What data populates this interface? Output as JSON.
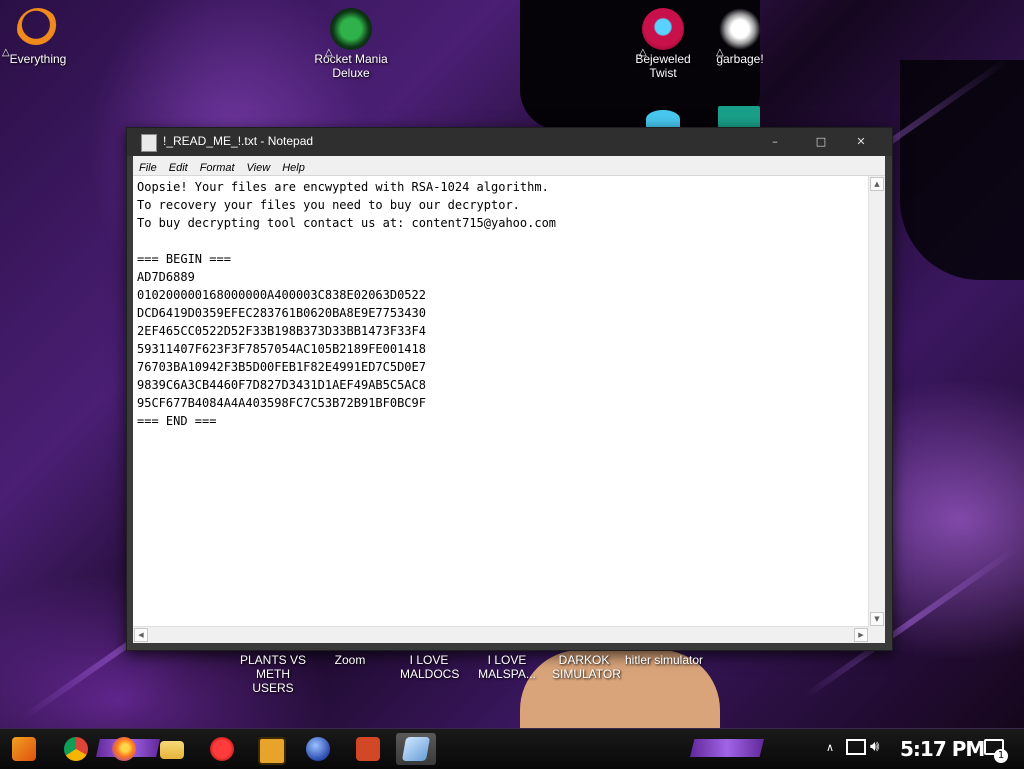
{
  "desktop": {
    "top_icons": [
      {
        "label": "Everything",
        "icon": "everything-search-icon",
        "color": "#f08a1c"
      },
      {
        "label": "Rocket Mania Deluxe",
        "icon": "rocket-mania-icon",
        "color": "#2fb24a"
      },
      {
        "label": "Bejeweled Twist",
        "icon": "bejeweled-gem-icon",
        "color": "#c8104a"
      },
      {
        "label": "garbage!",
        "icon": "garbage-dragon-icon",
        "color": "#ffffff"
      }
    ],
    "bottom_labels": [
      "PLANTS VS METH USERS",
      "Zoom",
      "I LOVE MALDOCS",
      "I LOVE MALSPA...",
      "DARKOK SIMULATOR",
      "hitler simulator"
    ]
  },
  "notepad": {
    "title": "!_READ_ME_!.txt - Notepad",
    "menu": [
      "File",
      "Edit",
      "Format",
      "View",
      "Help"
    ],
    "window_buttons": {
      "minimize": "–",
      "maximize": "□",
      "close": "✕"
    },
    "content": "Oopsie! Your files are encwypted with RSA-1024 algorithm.\nTo recovery your files you need to buy our decryptor.\nTo buy decrypting tool contact us at: content715@yahoo.com\n\n=== BEGIN ===\nAD7D6889\n010200000168000000A400003C838E02063D0522\nDCD6419D0359EFEC283761B0620BA8E9E7753430\n2EF465CC0522D52F33B198B373D33BB1473F33F4\n59311407F623F3F7857054AC105B2189FE001418\n76703BA10942F3B5D00FEB1F82E4991ED7C5D0E7\n9839C6A3CB4460F7D827D3431D1AEF49AB5C5AC8\n95CF677B4084A4A403598FC7C53B72B91BF0BC9F\n=== END ==="
  },
  "taskbar": {
    "apps": [
      {
        "name": "start-button",
        "icon": "start-icon",
        "color": "#f0a020"
      },
      {
        "name": "chrome",
        "icon": "chrome-icon",
        "color": "#4285f4"
      },
      {
        "name": "firefox",
        "icon": "firefox-icon",
        "color": "#ff7b1c"
      },
      {
        "name": "file-explorer",
        "icon": "folder-icon",
        "color": "#f5c542"
      },
      {
        "name": "app-red-face",
        "icon": "red-face-icon",
        "color": "#d81b1b"
      },
      {
        "name": "dreamweaver",
        "icon": "dreamweaver-icon",
        "color": "#e8a32a"
      },
      {
        "name": "network-globe",
        "icon": "globe-icon",
        "color": "#4a7de0"
      },
      {
        "name": "powerpoint",
        "icon": "powerpoint-icon",
        "color": "#d24726"
      },
      {
        "name": "notepad",
        "icon": "notepad-icon",
        "color": "#8ab8e8"
      }
    ],
    "clock": "5:17 PM",
    "notification_count": "1"
  }
}
